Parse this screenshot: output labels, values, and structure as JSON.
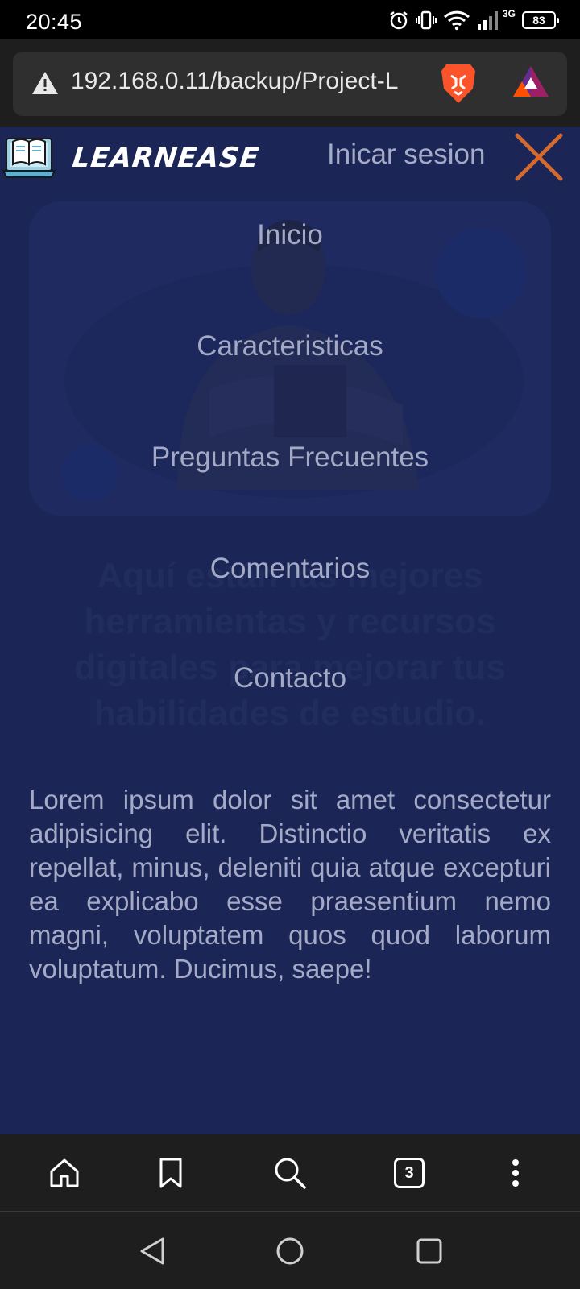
{
  "status_bar": {
    "time": "20:45",
    "network": "3G",
    "battery": "83",
    "icons": [
      "alarm-icon",
      "vibrate-icon",
      "wifi-icon",
      "signal-icon",
      "battery-icon"
    ]
  },
  "browser": {
    "url": "192.168.0.11/backup/Project-L",
    "icons": [
      "warning-icon",
      "brave-lion-icon",
      "bat-rewards-icon"
    ],
    "toolbar_icons": [
      "home-icon",
      "bookmark-icon",
      "search-icon",
      "tabs-icon",
      "more-icon"
    ],
    "tab_count": "3"
  },
  "header": {
    "logo_text": "LEARNEASE",
    "login_label": "Inicar sesion",
    "close_icon": "close-icon",
    "close_color": "#d2692f"
  },
  "nav": {
    "items": [
      {
        "label": "Inicio"
      },
      {
        "label": "Caracteristicas"
      },
      {
        "label": "Preguntas Frecuentes"
      },
      {
        "label": "Comentarios"
      },
      {
        "label": "Contacto"
      }
    ]
  },
  "hero": {
    "heading": "Aquí están las mejores herramientas y recursos digitales para mejorar tus habilidades de estudio."
  },
  "body_text": "Lorem ipsum dolor sit amet consectetur adipisicing elit. Distinctio veritatis ex repellat, minus, deleniti quia atque excepturi ea explicabo esse praesentium nemo magni, voluptatem quos quod laborum voluptatum. Ducimus, saepe!",
  "colors": {
    "page_bg": "#1b2657",
    "menu_text": "#a4aac6",
    "accent": "#d2692f"
  },
  "android_nav": [
    "back-icon",
    "home-circle-icon",
    "recents-icon"
  ]
}
